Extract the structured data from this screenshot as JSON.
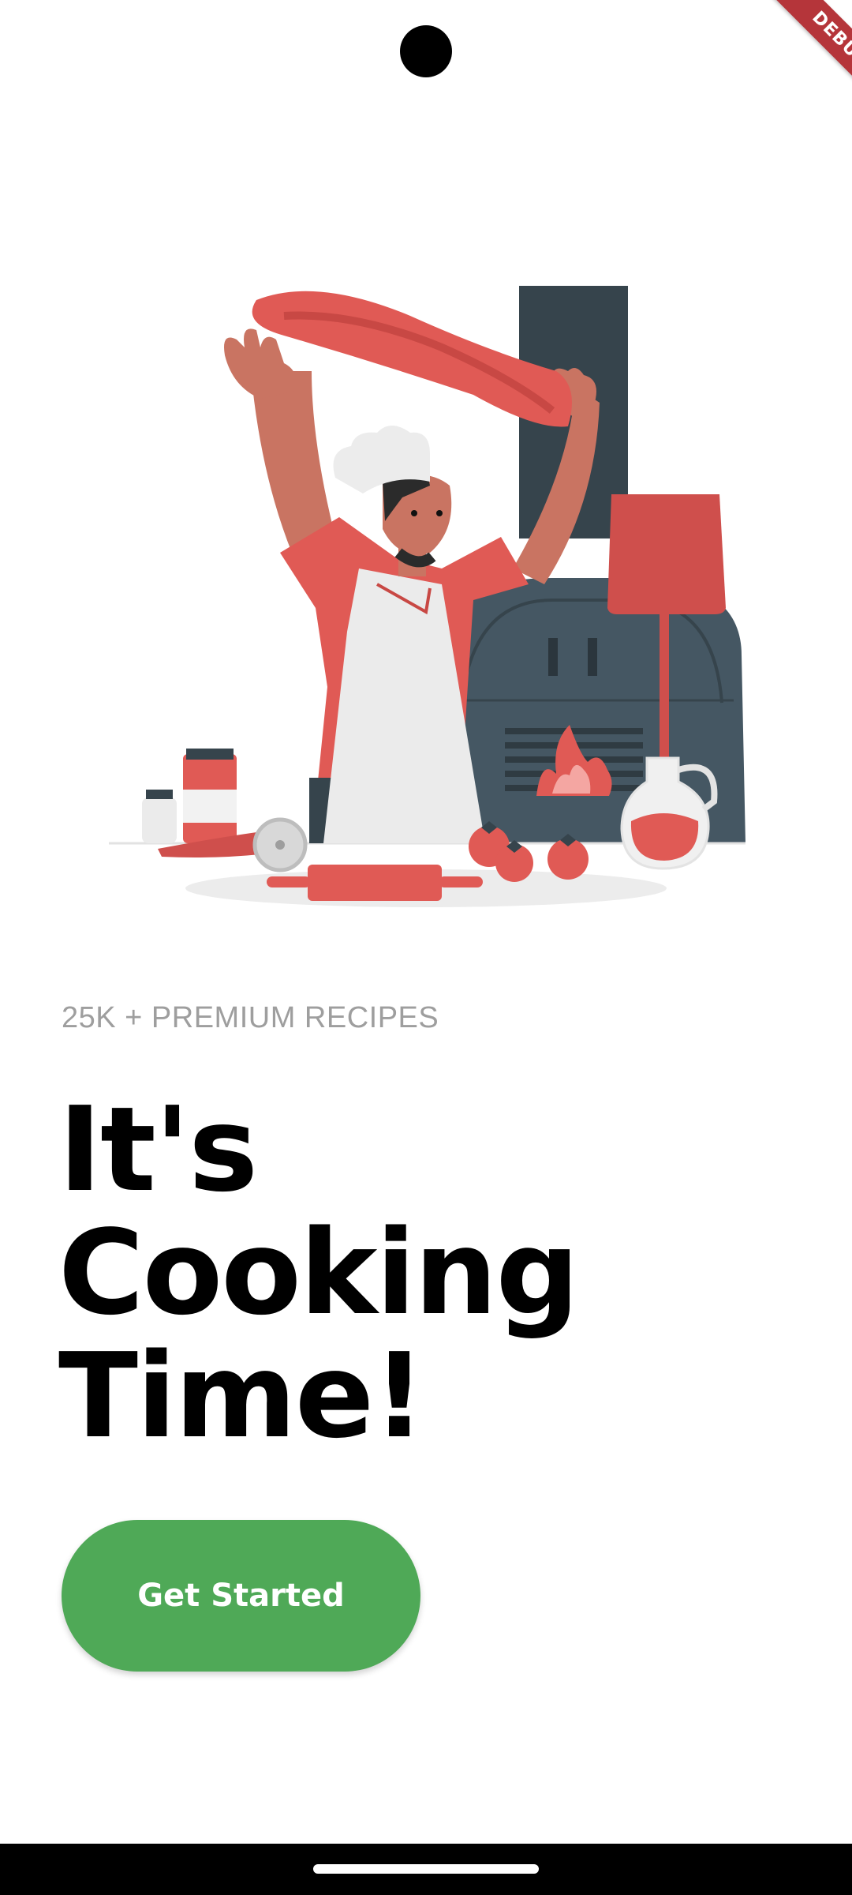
{
  "debug_banner": {
    "label": "DEBUG"
  },
  "onboarding": {
    "subtitle": "25K + PREMIUM RECIPES",
    "headline_lines": [
      "It's",
      "Cooking",
      "Time!"
    ],
    "cta_label": "Get Started"
  },
  "illustration": {
    "name": "chef tossing pizza dough beside oven"
  },
  "colors": {
    "accent_red": "#e05a55",
    "oven": "#3e4e58",
    "button_green": "#4fa957",
    "subtitle_gray": "#9e9e9e"
  }
}
